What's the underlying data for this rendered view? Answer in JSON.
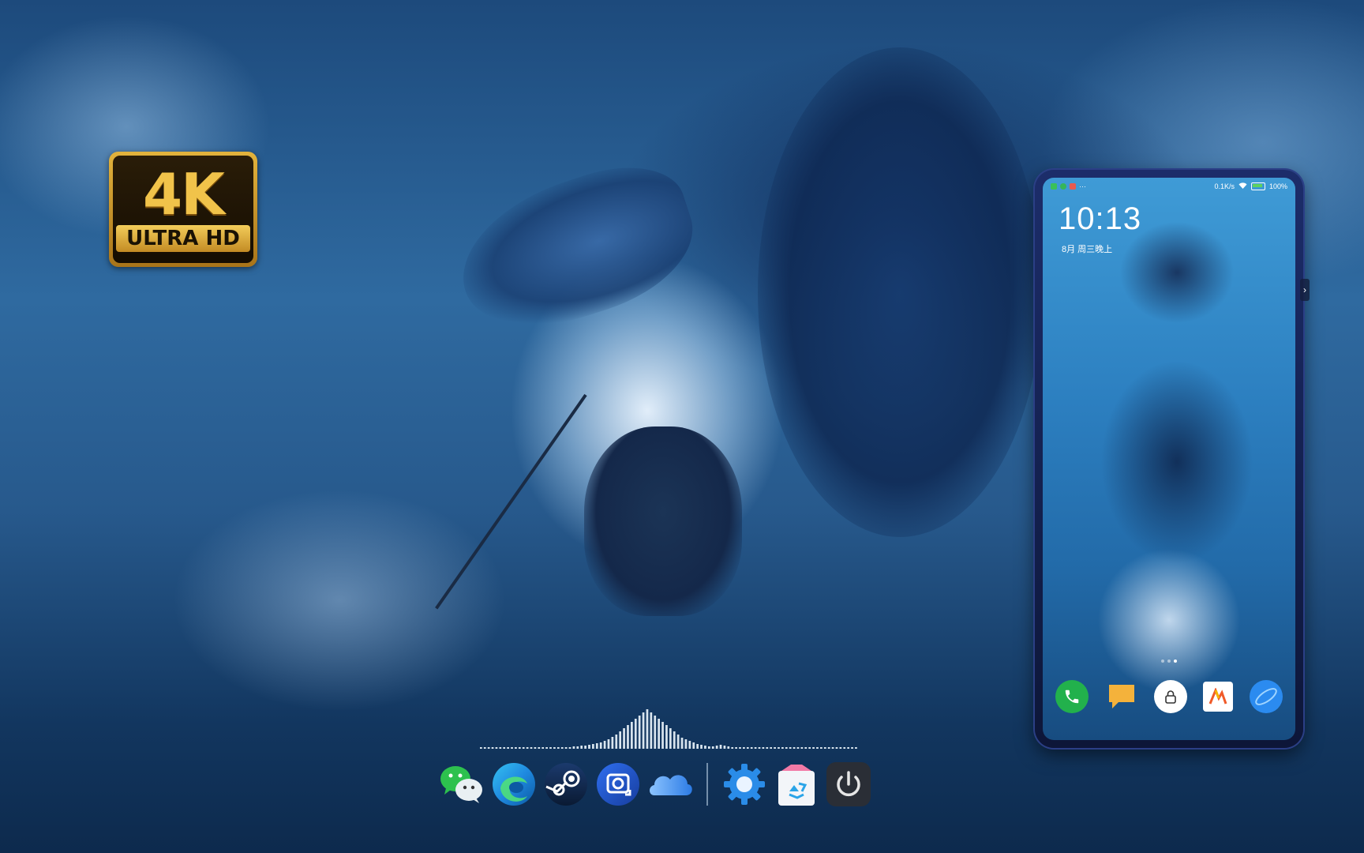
{
  "desktop": {
    "wallpaper": "icy-dragon-warrior",
    "badge": {
      "main": "4K",
      "sub": "ULTRA HD"
    }
  },
  "phone": {
    "status_bar": {
      "left_icons": [
        "app-notification-icon",
        "shield-icon",
        "app-icon",
        "more-dots"
      ],
      "more": "···",
      "network_speed": "0.1K/s",
      "battery": "100%"
    },
    "clock": "10:13",
    "date": "8月 周三晚上",
    "dock": [
      {
        "name": "phone-app",
        "color": "#22b14c"
      },
      {
        "name": "notes-app",
        "color": "#f4b23b"
      },
      {
        "name": "lock-app",
        "color": "#ffffff"
      },
      {
        "name": "office-app",
        "color": "#ffffff"
      },
      {
        "name": "browser-app",
        "color": "#2b8bf0"
      }
    ],
    "pager": {
      "count": 3,
      "active": 2
    }
  },
  "taskbar": {
    "apps": [
      "wechat",
      "edge",
      "steam",
      "screenshot",
      "onedrive"
    ],
    "system": [
      "settings",
      "recycle-bin",
      "power"
    ]
  },
  "visualizer": {
    "levels": [
      2,
      2,
      2,
      2,
      2,
      2,
      2,
      2,
      2,
      2,
      2,
      2,
      2,
      2,
      2,
      2,
      2,
      2,
      2,
      2,
      2,
      2,
      2,
      2,
      3,
      3,
      4,
      4,
      5,
      6,
      7,
      8,
      10,
      12,
      15,
      18,
      22,
      26,
      30,
      34,
      38,
      42,
      46,
      50,
      46,
      42,
      38,
      34,
      30,
      26,
      22,
      18,
      14,
      12,
      10,
      8,
      6,
      5,
      4,
      3,
      3,
      4,
      5,
      4,
      3,
      2,
      2,
      2,
      2,
      2,
      2,
      2,
      2,
      2,
      2,
      2,
      2,
      2,
      2,
      2,
      2,
      2,
      2,
      2,
      2,
      2,
      2,
      2,
      2,
      2,
      2,
      2,
      2,
      2,
      2,
      2,
      2,
      2
    ]
  }
}
